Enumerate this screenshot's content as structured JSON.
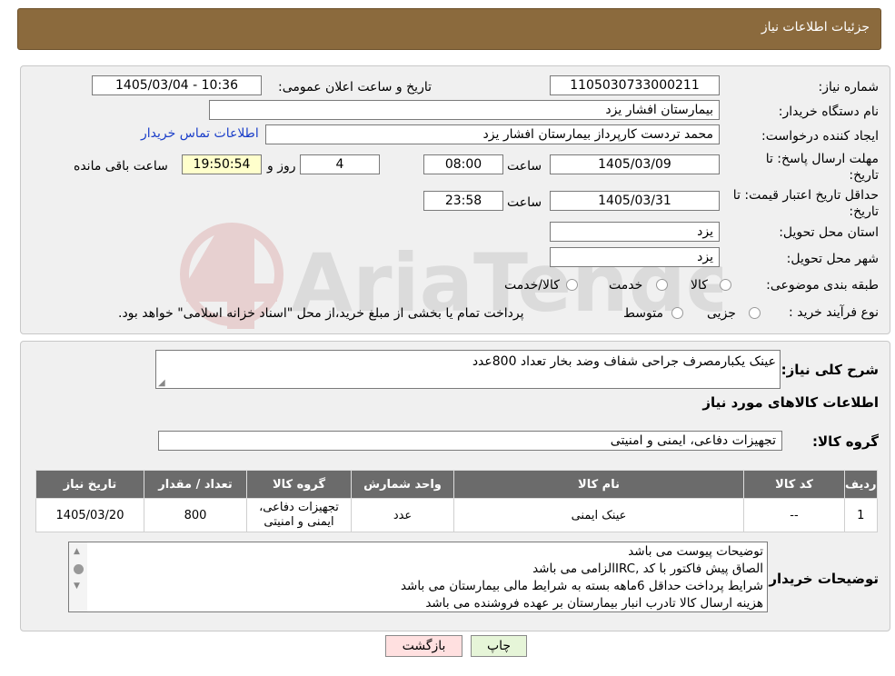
{
  "header": {
    "title": "جزئیات اطلاعات نیاز"
  },
  "form": {
    "need_number_label": "شماره نیاز:",
    "need_number": "1105030733000211",
    "announce_label": "تاریخ و ساعت اعلان عمومی:",
    "announce_value": "1405/03/04 - 10:36",
    "buyer_org_label": "نام دستگاه خریدار:",
    "buyer_org": "بیمارستان افشار یزد",
    "creator_label": "ایجاد کننده درخواست:",
    "creator": "محمد تردست کارپرداز بیمارستان افشار یزد",
    "contact_link": "اطلاعات تماس خریدار",
    "deadline_label": "مهلت ارسال پاسخ: تا تاریخ:",
    "deadline_date": "1405/03/09",
    "time_word": "ساعت",
    "deadline_time": "08:00",
    "days": "4",
    "days_word": "روز و",
    "remaining_time": "19:50:54",
    "remaining_word": "ساعت باقی مانده",
    "validity_label": "حداقل تاریخ اعتبار قیمت: تا تاریخ:",
    "validity_date": "1405/03/31",
    "validity_time": "23:58",
    "province_label": "استان محل تحویل:",
    "province": "یزد",
    "city_label": "شهر محل تحویل:",
    "city": "یزد",
    "category_label": "طبقه بندی موضوعی:",
    "category_options": [
      "کالا",
      "خدمت",
      "کالا/خدمت"
    ],
    "purchase_label": "نوع فرآیند خرید :",
    "purchase_options": [
      "جزیی",
      "متوسط"
    ],
    "purchase_note": "پرداخت تمام یا بخشی از مبلغ خرید،از محل \"اسناد خزانه اسلامی\" خواهد بود."
  },
  "details": {
    "summary_label": "شرح کلی نیاز:",
    "summary": "عینک یکبارمصرف جراحی شفاف وضد بخار تعداد 800عدد",
    "goods_info_title": "اطلاعات کالاهای مورد نیاز",
    "goods_group_label": "گروه کالا:",
    "goods_group": "تجهیزات دفاعی، ایمنی و امنیتی"
  },
  "table": {
    "headers": [
      "ردیف",
      "کد کالا",
      "نام کالا",
      "واحد شمارش",
      "گروه کالا",
      "تعداد / مقدار",
      "تاریخ نیاز"
    ],
    "rows": [
      [
        "1",
        "--",
        "عینک ایمنی",
        "عدد",
        "تجهیزات دفاعی، ایمنی و امنیتی",
        "800",
        "1405/03/20"
      ]
    ]
  },
  "notes": {
    "label": "توضیحات خریدار:",
    "lines": [
      "توضیحات پیوست می باشد",
      "الصاق پیش فاکتور با کد  ,IRCالزامی می باشد",
      "شرایط پرداخت حداقل 6ماهه بسته به شرایط مالی بیمارستان می باشد",
      "هزینه ارسال کالا تادرب انبار بیمارستان بر عهده فروشنده می باشد"
    ]
  },
  "buttons": {
    "back": "بازگشت",
    "print": "چاپ"
  },
  "watermark": {
    "text": "AriaTender.neT"
  }
}
